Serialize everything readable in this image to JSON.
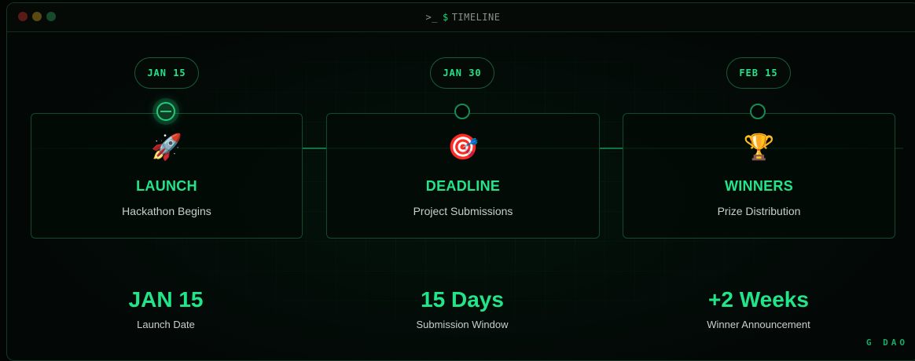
{
  "window": {
    "title_prompt": ">_",
    "title_dollar": "$",
    "title": "TIMELINE"
  },
  "milestones": [
    {
      "date": "JAN 15",
      "icon": "🚀",
      "icon_name": "rocket-icon",
      "title": "LAUNCH",
      "subtitle": "Hackathon Begins",
      "active": true
    },
    {
      "date": "JAN 30",
      "icon": "🎯",
      "icon_name": "target-icon",
      "title": "DEADLINE",
      "subtitle": "Project Submissions",
      "active": false
    },
    {
      "date": "FEB 15",
      "icon": "🏆",
      "icon_name": "trophy-icon",
      "title": "WINNERS",
      "subtitle": "Prize Distribution",
      "active": false
    }
  ],
  "stats": [
    {
      "value": "JAN 15",
      "label": "Launch Date"
    },
    {
      "value": "15 Days",
      "label": "Submission Window"
    },
    {
      "value": "+2 Weeks",
      "label": "Winner Announcement"
    }
  ],
  "footer": {
    "tag": "G DAO"
  },
  "colors": {
    "accent": "#22e58a",
    "border": "#124a30",
    "background": "#030806"
  }
}
